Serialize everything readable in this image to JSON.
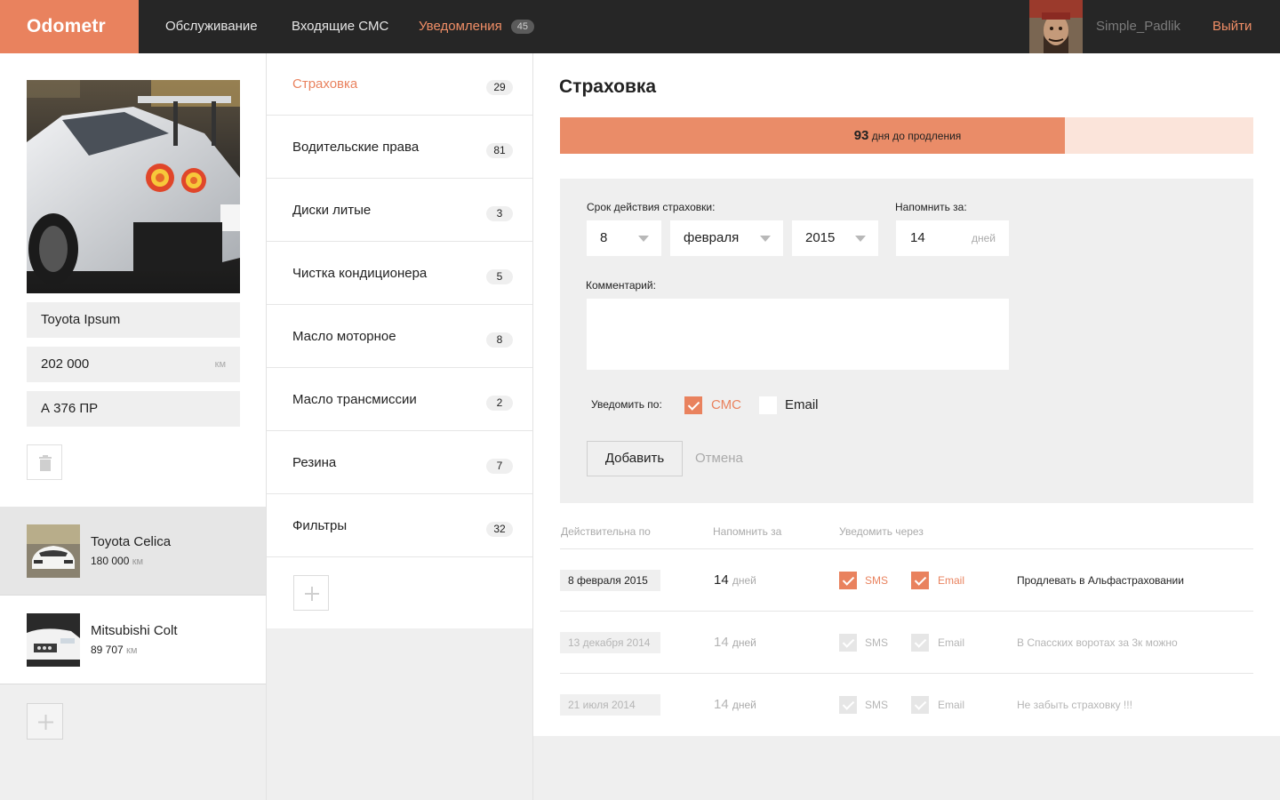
{
  "header": {
    "logo": "Odometr",
    "nav": [
      {
        "label": "Обслуживание"
      },
      {
        "label": "Входящие СМС"
      },
      {
        "label": "Уведомления",
        "badge": "45",
        "active": true
      }
    ],
    "username": "Simple_Padlik",
    "logout": "Выйти"
  },
  "current_car": {
    "name": "Toyota Ipsum",
    "mileage": "202 000",
    "mileage_unit": "км",
    "plate": "А 376 ПР"
  },
  "other_cars": [
    {
      "name": "Toyota Celica",
      "km": "180 000",
      "unit": "км"
    },
    {
      "name": "Mitsubishi Colt",
      "km": "89 707",
      "unit": "км"
    }
  ],
  "categories": [
    {
      "label": "Страховка",
      "count": "29",
      "active": true
    },
    {
      "label": "Водительские права",
      "count": "81"
    },
    {
      "label": "Диски литые",
      "count": "3"
    },
    {
      "label": "Чистка кондиционера",
      "count": "5"
    },
    {
      "label": "Масло моторное",
      "count": "8"
    },
    {
      "label": "Масло трансмиссии",
      "count": "2"
    },
    {
      "label": "Резина",
      "count": "7"
    },
    {
      "label": "Фильтры",
      "count": "32"
    }
  ],
  "main": {
    "title": "Страховка",
    "progress": {
      "days": "93",
      "text": " дня до продления",
      "fraction": 0.728
    },
    "form": {
      "validity_label": "Срок действия страховки:",
      "day": "8",
      "month": "февраля",
      "year": "2015",
      "remind_label": "Напомнить за:",
      "remind_value": "14",
      "remind_unit": "дней",
      "comment_label": "Комментарий:",
      "notify_label": "Уведомить по:",
      "sms_label": "СМС",
      "email_label": "Email",
      "add_button": "Добавить",
      "cancel_button": "Отмена"
    },
    "table": {
      "headers": [
        "Действительна по",
        "Напомнить за",
        "Уведомить через"
      ],
      "rows": [
        {
          "date": "8 февраля 2015",
          "days": "14",
          "days_unit": "дней",
          "sms": "SMS",
          "email": "Email",
          "note": "Продлевать в  Альфастраховании"
        },
        {
          "date": "13 декабря 2014",
          "days": "14",
          "days_unit": "дней",
          "sms": "SMS",
          "email": "Email",
          "note": "В Спасских воротах за 3к можно"
        },
        {
          "date": "21 июля 2014",
          "days": "14",
          "days_unit": "дней",
          "sms": "SMS",
          "email": "Email",
          "note": "Не забыть страховку !!!"
        }
      ]
    }
  },
  "colors": {
    "accent": "#e9825e",
    "header_bg": "#262626",
    "progress_bg": "#fbe4da"
  }
}
